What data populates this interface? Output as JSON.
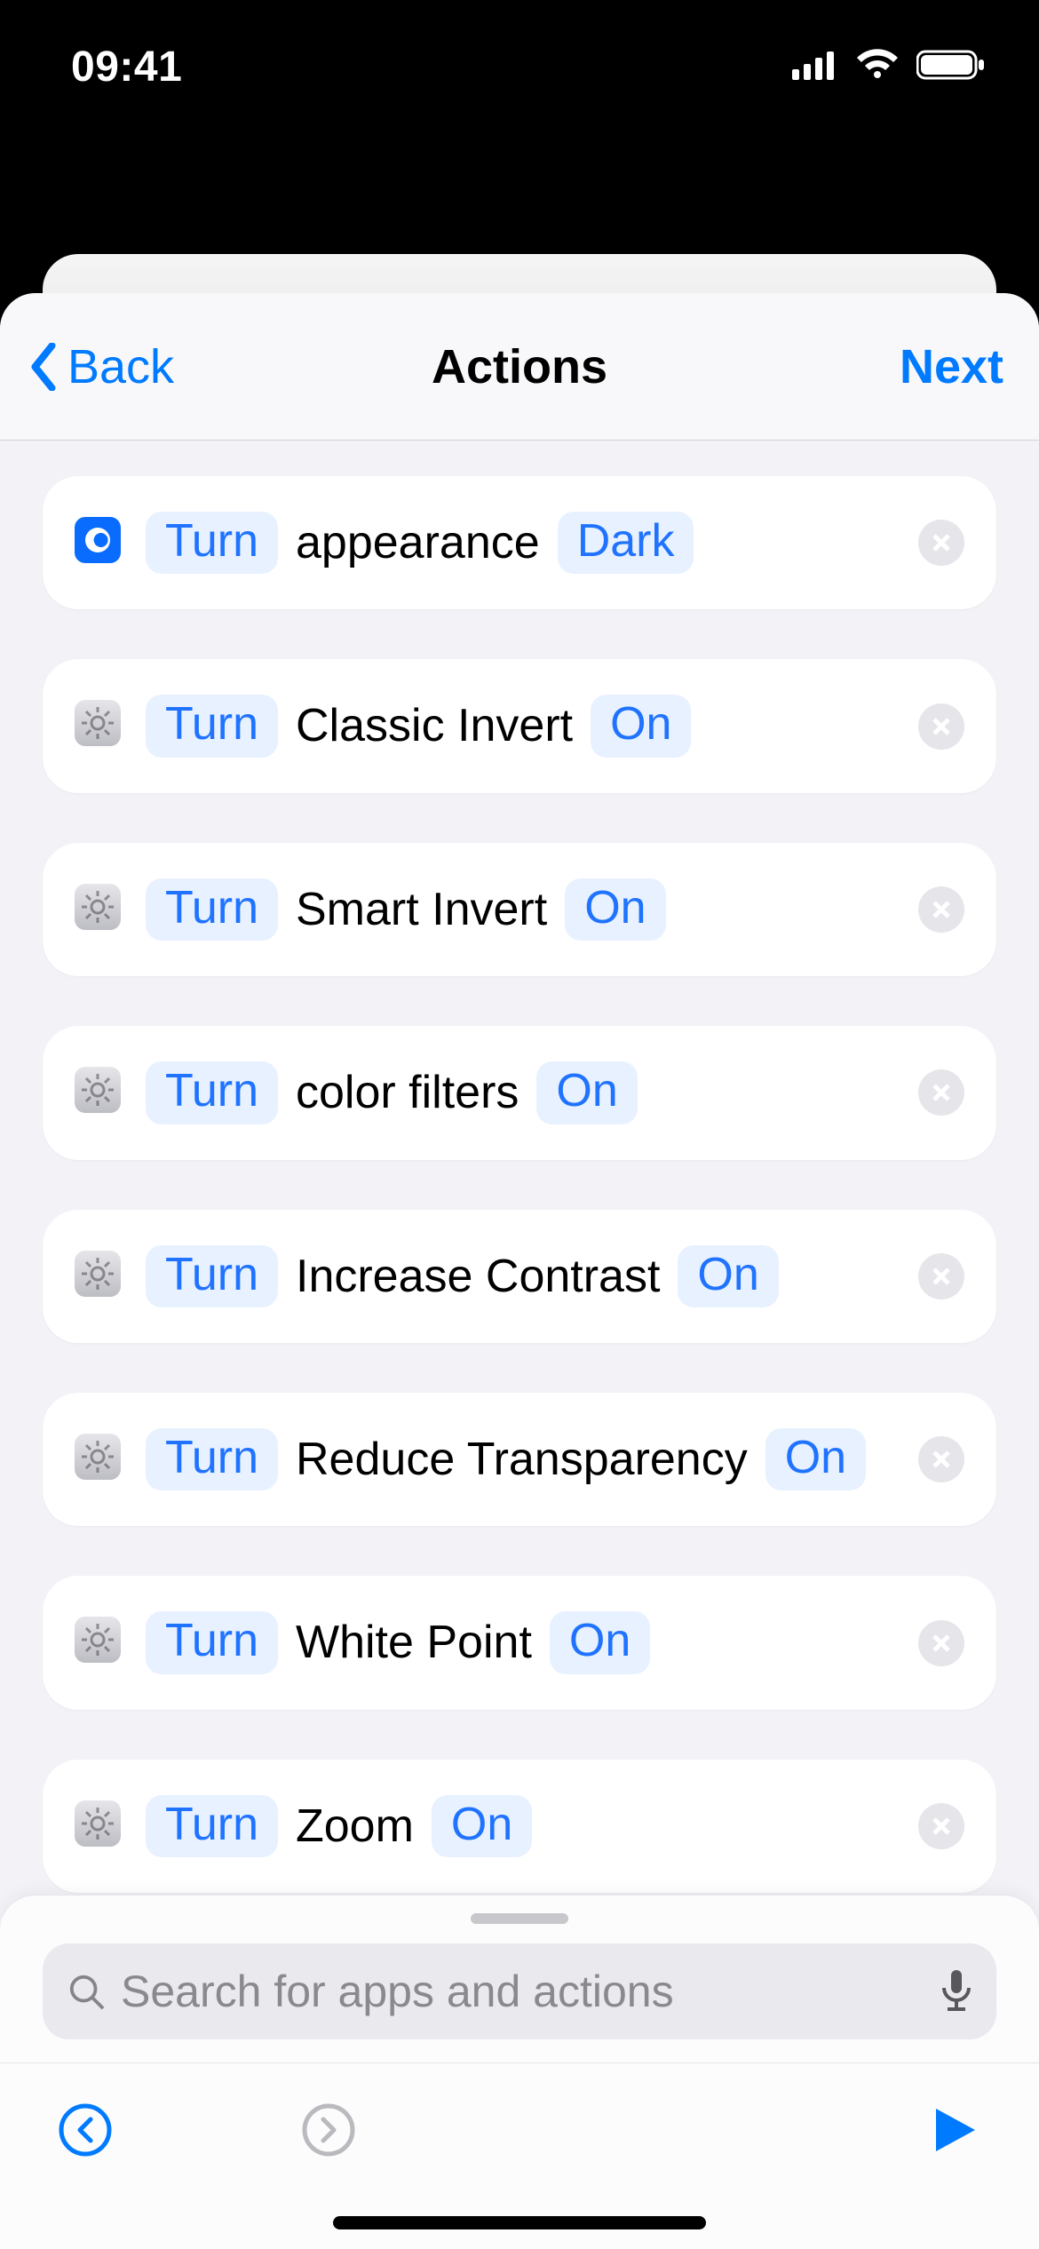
{
  "status": {
    "time": "09:41"
  },
  "nav": {
    "back_label": "Back",
    "title": "Actions",
    "next_label": "Next"
  },
  "actions": [
    {
      "icon": "appearance",
      "verb": "Turn",
      "subject": "appearance",
      "state": "Dark"
    },
    {
      "icon": "settings",
      "verb": "Turn",
      "subject": "Classic Invert",
      "state": "On"
    },
    {
      "icon": "settings",
      "verb": "Turn",
      "subject": "Smart Invert",
      "state": "On"
    },
    {
      "icon": "settings",
      "verb": "Turn",
      "subject": "color filters",
      "state": "On"
    },
    {
      "icon": "settings",
      "verb": "Turn",
      "subject": "Increase Contrast",
      "state": "On"
    },
    {
      "icon": "settings",
      "verb": "Turn",
      "subject": "Reduce Transparency",
      "state": "On"
    },
    {
      "icon": "settings",
      "verb": "Turn",
      "subject": "White Point",
      "state": "On"
    },
    {
      "icon": "settings",
      "verb": "Turn",
      "subject": "Zoom",
      "state": "On"
    }
  ],
  "search": {
    "placeholder": "Search for apps and actions"
  },
  "colors": {
    "accent": "#007aff"
  }
}
